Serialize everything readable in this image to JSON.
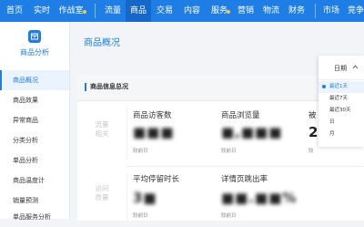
{
  "topnav": {
    "items": [
      {
        "label": "首页"
      },
      {
        "label": "实时"
      },
      {
        "label": "作战室"
      },
      {
        "label": "流量"
      },
      {
        "label": "商品"
      },
      {
        "label": "交易"
      },
      {
        "label": "内容"
      },
      {
        "label": "服务"
      },
      {
        "label": "营销"
      },
      {
        "label": "物流"
      },
      {
        "label": "财务"
      },
      {
        "label": "市场"
      },
      {
        "label": "竞争"
      }
    ],
    "active_index": 4,
    "colors": {
      "bar": "#1f7ee6",
      "active": "#1567c8",
      "dot": "#ffc53d"
    }
  },
  "sidebar": {
    "title": "商品分析",
    "logo_icon": "package-icon",
    "items": [
      {
        "label": "商品概况"
      },
      {
        "label": "商品效果"
      },
      {
        "label": "异常商品"
      },
      {
        "label": "分类分析"
      },
      {
        "label": "单品分析"
      },
      {
        "label": "商品温度计"
      },
      {
        "label": "销量预测"
      },
      {
        "label": "单品服务分析"
      }
    ],
    "active_index": 0
  },
  "main": {
    "page_title": "商品概况",
    "section_title": "商品信息总况",
    "rows": [
      {
        "label": "流量相关",
        "metrics": [
          {
            "label": "商品访客数",
            "value": "■■■",
            "sub": "较前日"
          },
          {
            "label": "商品浏览量",
            "value": "■,■■■",
            "sub": "较前日"
          },
          {
            "label": "被",
            "value": "2",
            "sub": "较"
          }
        ]
      },
      {
        "label": "访问质量",
        "metrics": [
          {
            "label": "平均停留时长",
            "value": "3■",
            "sub": "较前日"
          },
          {
            "label": "详情页跳出率",
            "value": "■■.■■%",
            "sub": "较前日"
          }
        ]
      }
    ]
  },
  "dropdown": {
    "label": "日期",
    "icon": "chevron-up-icon",
    "options": [
      {
        "label": "最近1天"
      },
      {
        "label": "最近7天"
      },
      {
        "label": "最近30天"
      },
      {
        "label": "日"
      },
      {
        "label": "月"
      }
    ],
    "selected_index": 0
  }
}
